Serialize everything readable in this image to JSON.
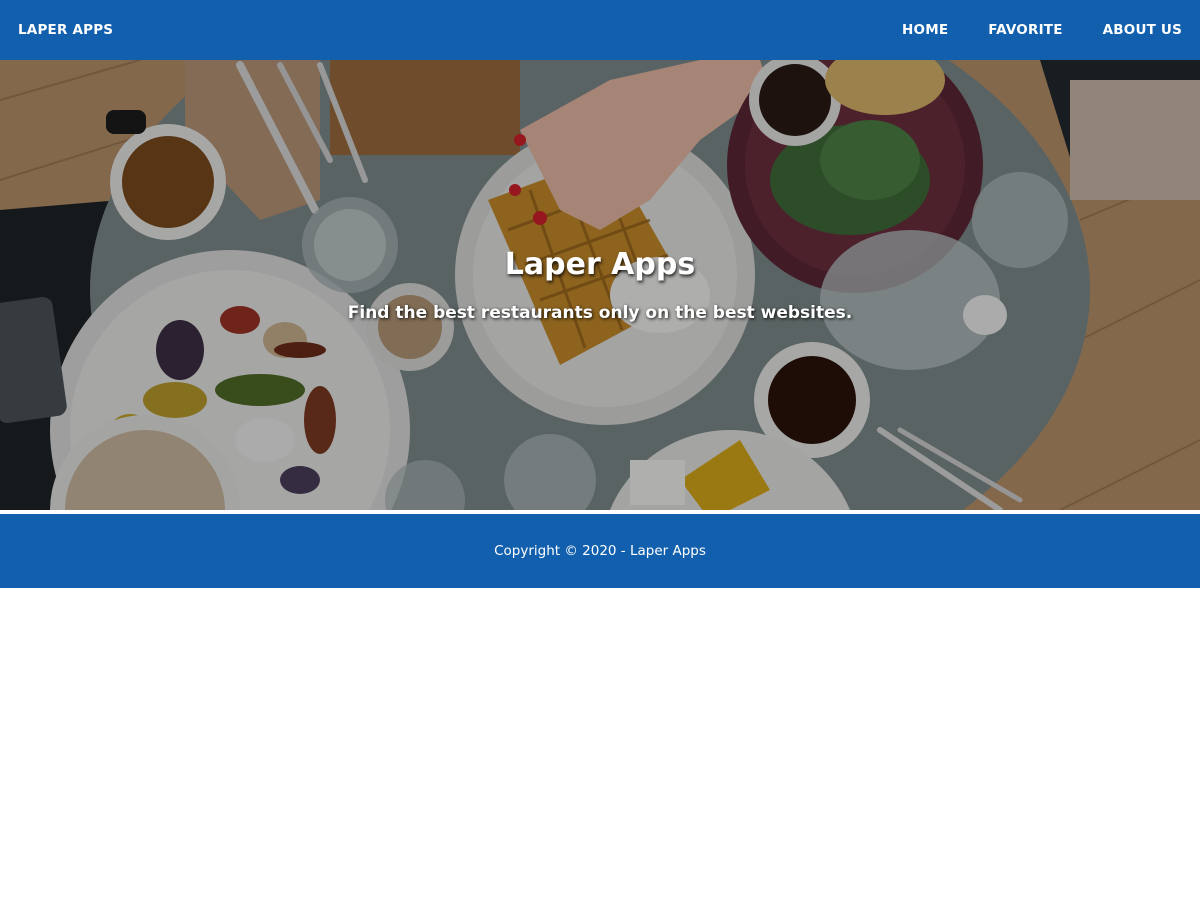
{
  "navbar": {
    "brand": "LAPER APPS",
    "links": [
      "HOME",
      "FAVORITE",
      "ABOUT US"
    ]
  },
  "hero": {
    "title": "Laper Apps",
    "subtitle": "Find the best restaurants only on the best websites."
  },
  "footer": {
    "copyright": "Copyright © 2020 - Laper Apps"
  },
  "colors": {
    "primary": "#1260ad",
    "text_on_primary": "#ffffff"
  }
}
